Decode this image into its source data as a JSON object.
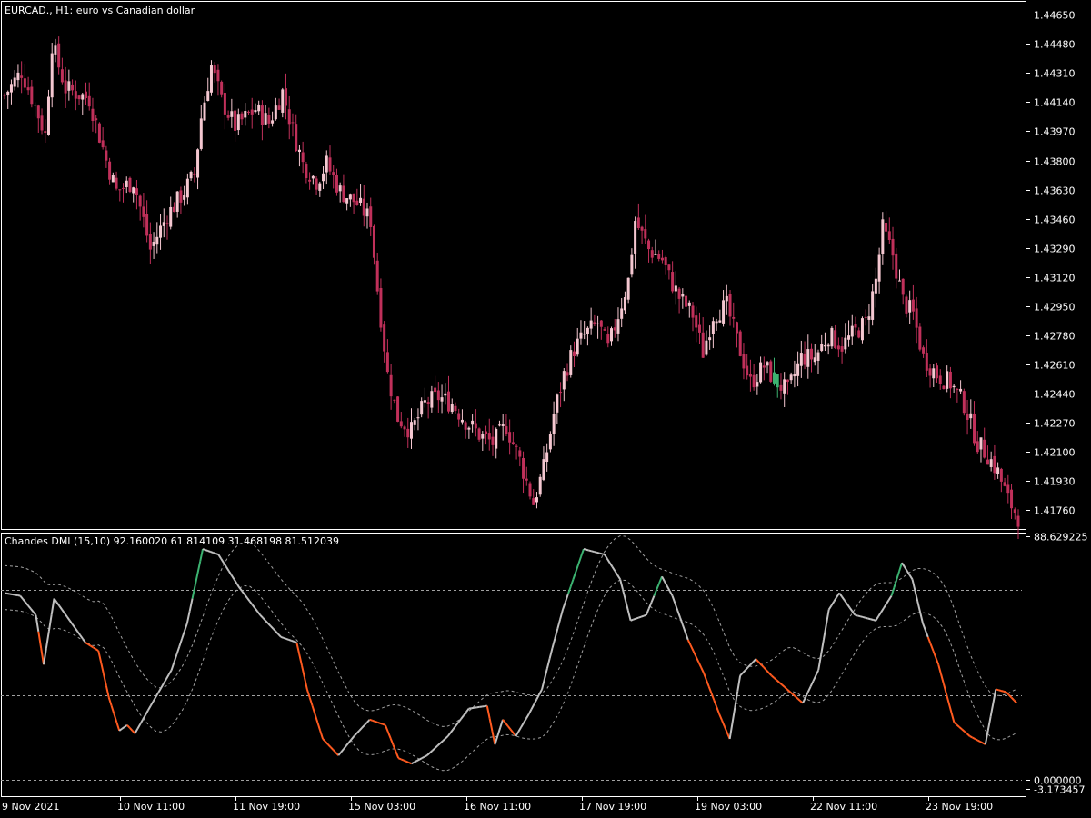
{
  "chart_data": [
    {
      "type": "candlestick",
      "title": "EURCAD., H1:  euro vs Canadian dollar",
      "colors": {
        "bull": "#f4c7d0",
        "bear": "#c0305a",
        "special": "#3cb371",
        "axis": "#ffffff"
      },
      "ylim": [
        1.4167,
        1.4471
      ],
      "yticks": [
        "1.44650",
        "1.44480",
        "1.44310",
        "1.44140",
        "1.43970",
        "1.43800",
        "1.43630",
        "1.43460",
        "1.43290",
        "1.43120",
        "1.42950",
        "1.42780",
        "1.42610",
        "1.42440",
        "1.42270",
        "1.42100",
        "1.41930",
        "1.41760"
      ],
      "xticks": [
        "9 Nov 2021",
        "10 Nov 11:00",
        "11 Nov 19:00",
        "15 Nov 03:00",
        "16 Nov 11:00",
        "17 Nov 19:00",
        "19 Nov 03:00",
        "22 Nov 11:00",
        "23 Nov 19:00"
      ],
      "close_path": [
        [
          0,
          1.4418
        ],
        [
          5,
          1.4432
        ],
        [
          9,
          1.4412
        ],
        [
          12,
          1.4395
        ],
        [
          14,
          1.4448
        ],
        [
          18,
          1.4422
        ],
        [
          25,
          1.4416
        ],
        [
          30,
          1.438
        ],
        [
          33,
          1.4362
        ],
        [
          38,
          1.4368
        ],
        [
          41,
          1.4345
        ],
        [
          43,
          1.4328
        ],
        [
          48,
          1.4348
        ],
        [
          53,
          1.4362
        ],
        [
          56,
          1.4372
        ],
        [
          58,
          1.4405
        ],
        [
          61,
          1.4435
        ],
        [
          64,
          1.4415
        ],
        [
          68,
          1.44
        ],
        [
          74,
          1.441
        ],
        [
          78,
          1.4402
        ],
        [
          82,
          1.442
        ],
        [
          85,
          1.4398
        ],
        [
          88,
          1.4378
        ],
        [
          92,
          1.4368
        ],
        [
          95,
          1.4378
        ],
        [
          99,
          1.4362
        ],
        [
          104,
          1.4355
        ],
        [
          108,
          1.4345
        ],
        [
          110,
          1.4305
        ],
        [
          113,
          1.4255
        ],
        [
          116,
          1.423
        ],
        [
          120,
          1.4222
        ],
        [
          124,
          1.4238
        ],
        [
          128,
          1.4242
        ],
        [
          132,
          1.4238
        ],
        [
          136,
          1.4228
        ],
        [
          140,
          1.422
        ],
        [
          144,
          1.4215
        ],
        [
          148,
          1.4225
        ],
        [
          152,
          1.4205
        ],
        [
          156,
          1.418
        ],
        [
          159,
          1.42
        ],
        [
          162,
          1.4232
        ],
        [
          165,
          1.4255
        ],
        [
          168,
          1.427
        ],
        [
          171,
          1.4278
        ],
        [
          175,
          1.4285
        ],
        [
          178,
          1.427
        ],
        [
          181,
          1.429
        ],
        [
          184,
          1.431
        ],
        [
          186,
          1.4345
        ],
        [
          190,
          1.4328
        ],
        [
          194,
          1.4322
        ],
        [
          196,
          1.4312
        ],
        [
          199,
          1.43
        ],
        [
          203,
          1.429
        ],
        [
          206,
          1.4268
        ],
        [
          209,
          1.429
        ],
        [
          213,
          1.4295
        ],
        [
          216,
          1.4275
        ],
        [
          220,
          1.425
        ],
        [
          224,
          1.426
        ],
        [
          228,
          1.425
        ],
        [
          231,
          1.4245
        ],
        [
          235,
          1.4265
        ],
        [
          239,
          1.4265
        ],
        [
          243,
          1.4278
        ],
        [
          247,
          1.4272
        ],
        [
          251,
          1.428
        ],
        [
          254,
          1.4285
        ],
        [
          257,
          1.431
        ],
        [
          259,
          1.434
        ],
        [
          262,
          1.4325
        ],
        [
          265,
          1.4298
        ],
        [
          268,
          1.429
        ],
        [
          271,
          1.4265
        ],
        [
          275,
          1.4255
        ],
        [
          279,
          1.425
        ],
        [
          283,
          1.4238
        ],
        [
          287,
          1.4215
        ],
        [
          290,
          1.4208
        ],
        [
          293,
          1.4198
        ],
        [
          296,
          1.4182
        ],
        [
          299,
          1.4172
        ]
      ]
    },
    {
      "type": "line",
      "title": "Chandes DMI (15,10) 92.160020 61.814109 31.468198 81.512039",
      "ylim": [
        -3.173457,
        88.629225
      ],
      "yticks": [
        "88.629225",
        "0.000000",
        "-3.173457"
      ],
      "colors": {
        "main": "#c0c0c0",
        "up": "#3cb371",
        "down": "#ff5a1f",
        "band": "#a0a0a0"
      },
      "levels": [
        69.0,
        31.0,
        0.0
      ]
    }
  ]
}
